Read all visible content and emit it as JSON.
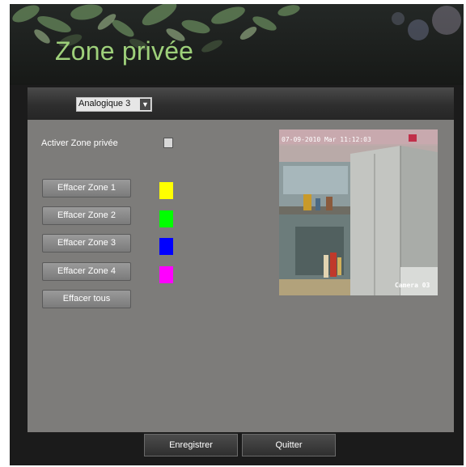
{
  "header": {
    "title": "Zone privée"
  },
  "channel_select": {
    "value": "Analogique 3"
  },
  "enable": {
    "label": "Activer Zone privée",
    "checked": false
  },
  "zones": [
    {
      "label": "Effacer Zone 1",
      "color": "#ffff00"
    },
    {
      "label": "Effacer Zone 2",
      "color": "#00ff00"
    },
    {
      "label": "Effacer Zone 3",
      "color": "#0000ff"
    },
    {
      "label": "Effacer Zone 4",
      "color": "#ff00ff"
    }
  ],
  "clear_all_label": "Effacer tous",
  "preview": {
    "timestamp": "07-09-2010 Mar 11:12:03",
    "camera_label": "Camera 03"
  },
  "footer": {
    "save_label": "Enregistrer",
    "quit_label": "Quitter"
  }
}
